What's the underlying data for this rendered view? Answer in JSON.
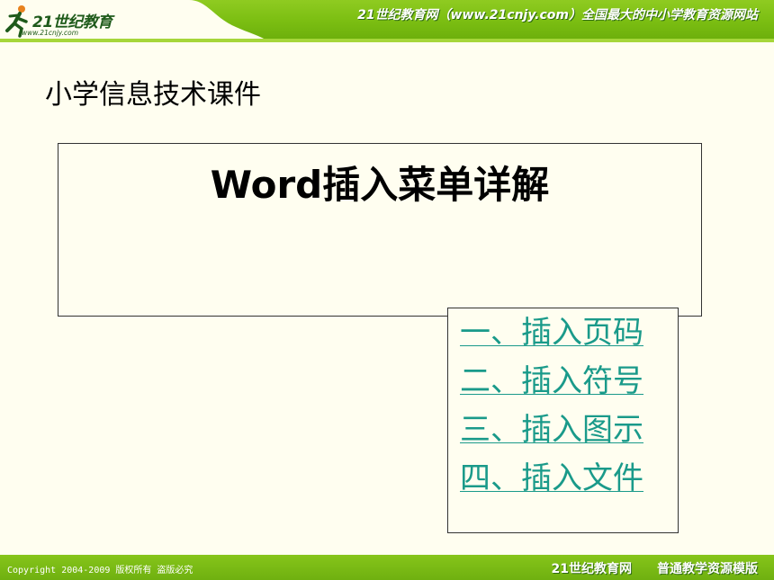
{
  "header": {
    "logo_text": "21世纪教育",
    "logo_url": "www.21cnjy.com",
    "slogan": "21世纪教育网（www.21cnjy.com）全国最大的中小学教育资源网站"
  },
  "slide": {
    "subtitle": "小学信息技术课件",
    "title": "Word插入菜单详解",
    "links": [
      {
        "label": "一、插入页码"
      },
      {
        "label": "二、插入符号"
      },
      {
        "label": "三、插入图示"
      },
      {
        "label": "四、插入文件"
      }
    ]
  },
  "footer": {
    "copyright": "Copyright 2004-2009 版权所有 盗版必究",
    "site_name": "21世纪教育网",
    "template_name": "普通教学资源模版"
  },
  "colors": {
    "header_green": "#7BBE12",
    "link_teal": "#1A9A8A",
    "slide_background": "#FFFEF0"
  }
}
